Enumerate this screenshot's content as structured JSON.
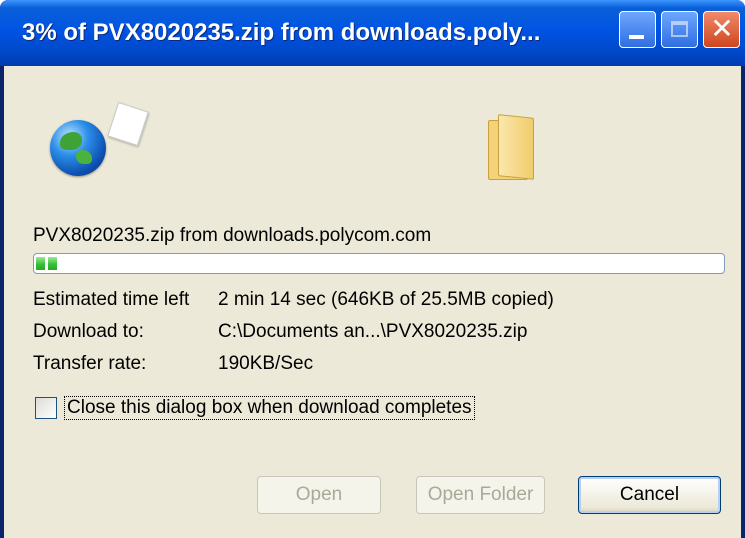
{
  "window": {
    "title": "3% of PVX8020235.zip from downloads.poly...",
    "controls": {
      "minimize_icon": "minimize-icon",
      "maximize_icon": "maximize-icon",
      "close_icon": "close-icon",
      "close_glyph": "✕"
    }
  },
  "icons": {
    "source": "globe-icon",
    "destination": "folder-icon"
  },
  "download": {
    "file_label": "PVX8020235.zip from downloads.polycom.com",
    "progress_fraction": 0.03
  },
  "details": {
    "time_left_label": "Estimated time left",
    "time_left_value": "2 min 14 sec (646KB of 25.5MB copied)",
    "download_to_label": "Download to:",
    "download_to_value": "C:\\Documents an...\\PVX8020235.zip",
    "transfer_rate_label": "Transfer rate:",
    "transfer_rate_value": "190KB/Sec"
  },
  "options": {
    "close_when_done_label": "Close this dialog box when download completes",
    "close_when_done_checked": false
  },
  "buttons": {
    "open": "Open",
    "open_folder": "Open Folder",
    "cancel": "Cancel"
  },
  "colors": {
    "titlebar": "#0054e3",
    "client_bg": "#ece9d8",
    "progress_fill": "#35c233"
  }
}
